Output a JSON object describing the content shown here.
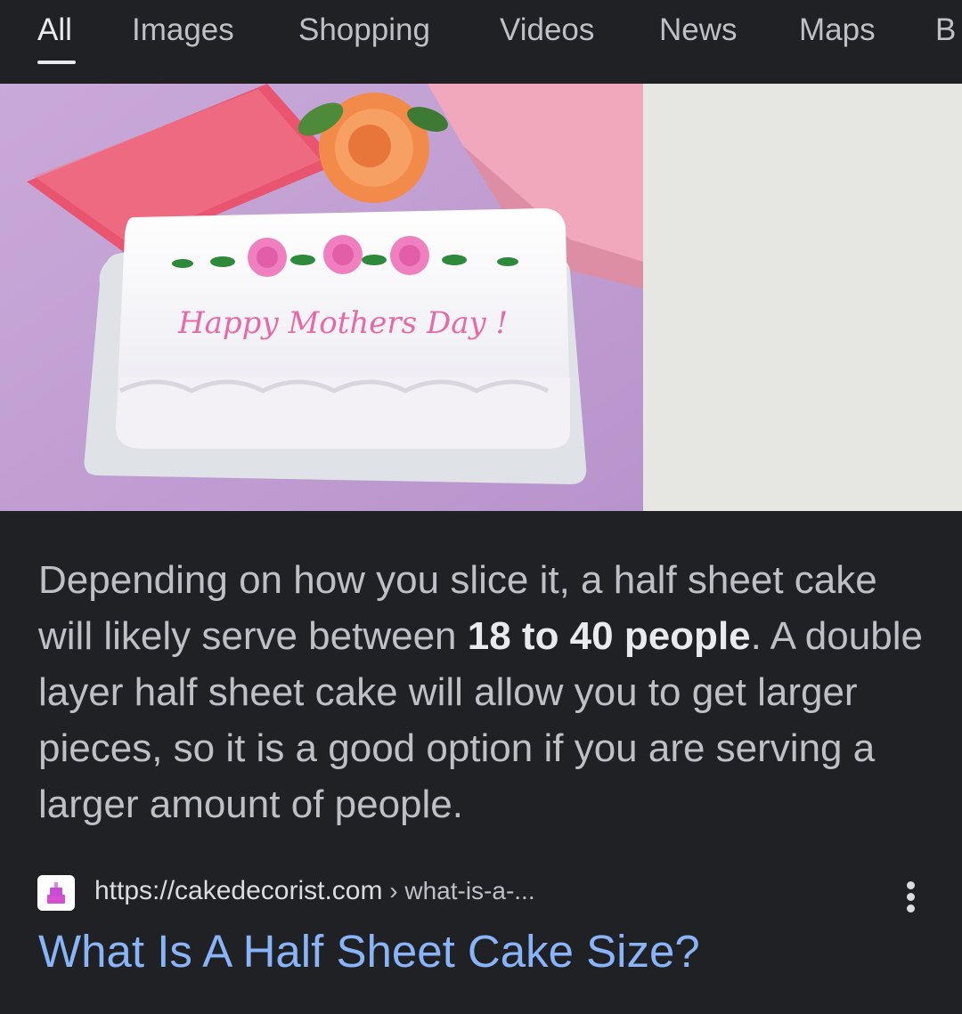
{
  "tabs": [
    {
      "label": "All",
      "active": true
    },
    {
      "label": "Images"
    },
    {
      "label": "Shopping"
    },
    {
      "label": "Videos"
    },
    {
      "label": "News"
    },
    {
      "label": "Maps"
    },
    {
      "label": "B"
    }
  ],
  "image": {
    "cake_lettering": "Happy Mothers Day !"
  },
  "snippet": {
    "text_before": "Depending on how you slice it, a half sheet cake will likely serve between ",
    "bold": "18 to 40 people",
    "text_after": ". A double layer half sheet cake will allow you to get larger pieces, so it is a good option if you are serving a larger amount of people."
  },
  "result": {
    "url_domain": "https://cakedecorist.com",
    "url_path": " › what-is-a-...",
    "title": "What Is A Half Sheet Cake Size?",
    "more_icon": "more-vert-icon"
  },
  "colors": {
    "background": "#202124",
    "link": "#8ab4f8",
    "text": "#bdc1c6",
    "hero_background": "#e6e6e2"
  }
}
